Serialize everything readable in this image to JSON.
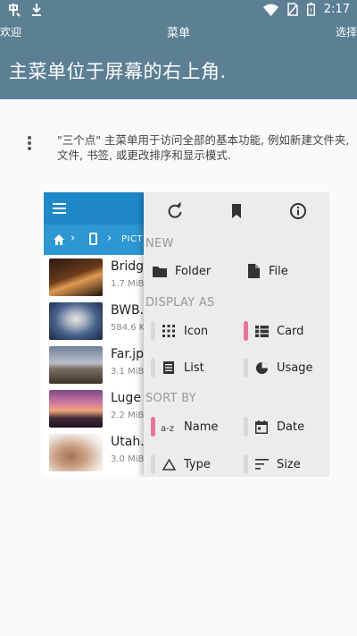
{
  "status_bar": {
    "time": "2:17"
  },
  "nav": {
    "back_label": "欢迎",
    "title": "菜单",
    "next_label": "选择"
  },
  "header": {
    "headline": "主菜单位于屏幕的右上角."
  },
  "description": "\"三个点\" 主菜单用于访问全部的基本功能, 例如新建文件夹, 文件, 书签, 或更改排序和显示模式.",
  "screenshot": {
    "breadcrumb_folder": "PICTU",
    "files": [
      {
        "name": "Bridge",
        "size": "1.7 MiB"
      },
      {
        "name": "BWB.",
        "size": "584.6 K"
      },
      {
        "name": "Far.jp",
        "size": "3.1 MiB"
      },
      {
        "name": "Luge",
        "size": "2.2 MiB"
      },
      {
        "name": "Utah.",
        "size": "3.0 MiB"
      }
    ],
    "menu": {
      "toolbar_icons": [
        "refresh-icon",
        "bookmark-icon",
        "info-icon"
      ],
      "new_header": "NEW",
      "new_folder": "Folder",
      "new_file": "File",
      "display_header": "DISPLAY AS",
      "display_icon": "Icon",
      "display_card": "Card",
      "display_list": "List",
      "display_usage": "Usage",
      "sort_header": "SORT BY",
      "sort_name": "Name",
      "sort_date": "Date",
      "sort_type": "Type",
      "sort_size": "Size",
      "selected": [
        "Card",
        "Name"
      ]
    }
  },
  "colors": {
    "app_bar": "#5c7f94",
    "explorer_blue": "#1e88c9",
    "accent_pink": "#e8739b"
  }
}
